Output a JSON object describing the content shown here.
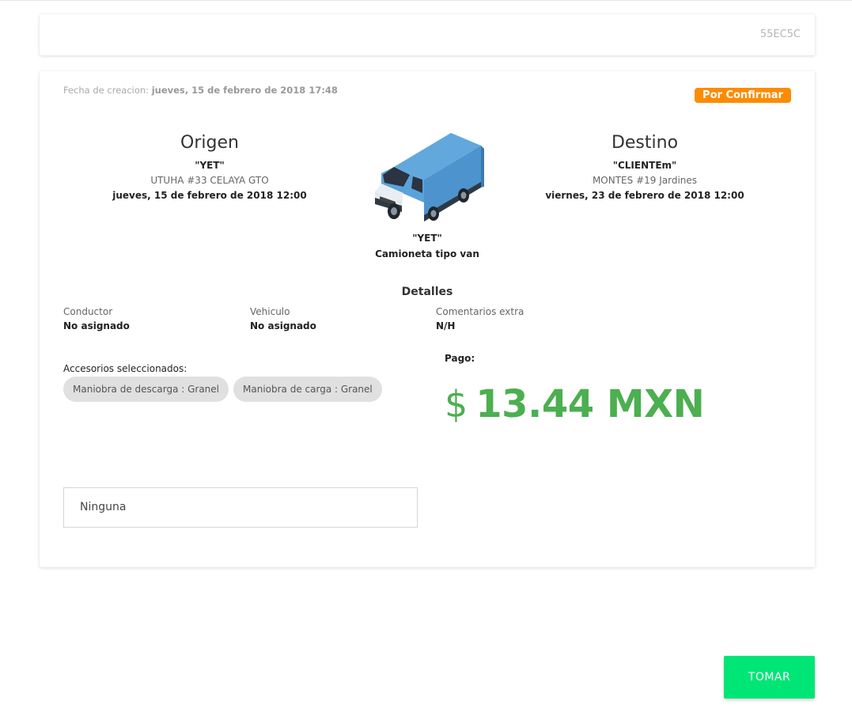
{
  "order": {
    "code": "55EC5C"
  },
  "created": {
    "label": "Fecha de creacion:",
    "date": "jueves, 15 de febrero de 2018 17:48"
  },
  "status": {
    "label": "Por Confirmar",
    "color": "#fb8c00"
  },
  "origin": {
    "title": "Origen",
    "name": "\"YET\"",
    "address": "UTUHA #33 CELAYA GTO",
    "date": "jueves, 15 de febrero de 2018 12:00"
  },
  "destination": {
    "title": "Destino",
    "name": "\"CLIENTEm\"",
    "address": "MONTES #19 Jardines",
    "date": "viernes, 23 de febrero de 2018 12:00"
  },
  "vehicle": {
    "icon": "van-icon",
    "name": "\"YET\"",
    "type": "Camioneta tipo van"
  },
  "details": {
    "title": "Detalles",
    "driver": {
      "label": "Conductor",
      "value": "No asignado"
    },
    "vehicle": {
      "label": "Vehiculo",
      "value": "No asignado"
    },
    "comments": {
      "label": "Comentarios extra",
      "value": "N/H"
    }
  },
  "accessories": {
    "label": "Accesorios seleccionados:",
    "items": [
      "Maniobra de descarga : Granel",
      "Maniobra de carga : Granel"
    ]
  },
  "payment": {
    "label": "Pago:",
    "symbol": "$",
    "amount": "13.44 MXN",
    "color": "#4caf50"
  },
  "comment_input": {
    "value": "Ninguna"
  },
  "actions": {
    "take_label": "TOMAR",
    "take_color": "#00e676"
  }
}
